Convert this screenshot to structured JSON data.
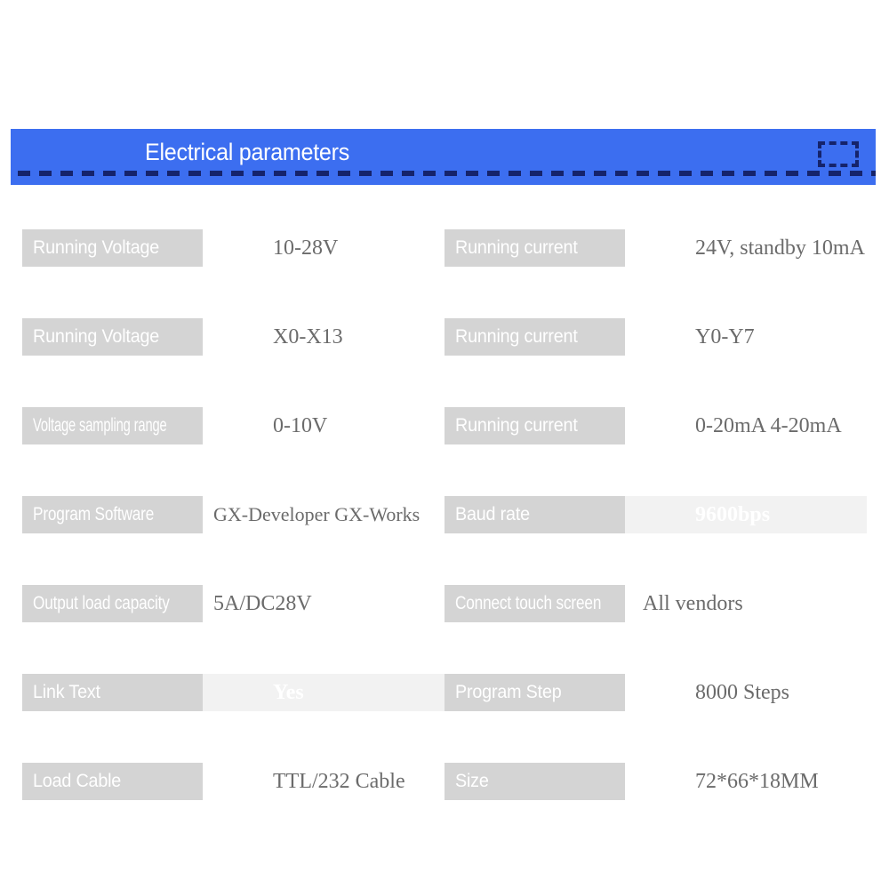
{
  "banner": {
    "title": "Electrical parameters",
    "accent_color": "#3c6ef0",
    "dash_color": "#15236b",
    "marker_icon": "dashed-rectangle-icon"
  },
  "theme": {
    "label_bg": "#d4d4d4",
    "label_text": "#ffffff",
    "value_text": "#6b6b6b",
    "ghost_strip_bg": "#f2f2f2",
    "page_bg": "#ffffff"
  },
  "parameters": {
    "rows": [
      {
        "left": {
          "label": "Running Voltage",
          "value": "10-28V",
          "ghost": false
        },
        "right": {
          "label": "Running current",
          "value": "24V, standby 10mA",
          "ghost": false
        }
      },
      {
        "left": {
          "label": "Running Voltage",
          "value": "X0-X13",
          "ghost": false
        },
        "right": {
          "label": "Running current",
          "value": "Y0-Y7",
          "ghost": false
        }
      },
      {
        "left": {
          "label": "Voltage sampling range",
          "value": "0-10V",
          "ghost": false
        },
        "right": {
          "label": "Running current",
          "value": "0-20mA  4-20mA",
          "ghost": false
        }
      },
      {
        "left": {
          "label": "Program Software",
          "value": "GX-Developer GX-Works",
          "ghost": false
        },
        "right": {
          "label": "Baud rate",
          "value": "9600bps",
          "ghost": true
        }
      },
      {
        "left": {
          "label": "Output load capacity",
          "value": "5A/DC28V",
          "ghost": false
        },
        "right": {
          "label": "Connect touch screen",
          "value": "All vendors",
          "ghost": false
        }
      },
      {
        "left": {
          "label": "Link Text",
          "value": "Yes",
          "ghost": true
        },
        "right": {
          "label": "Program Step",
          "value": "8000 Steps",
          "ghost": false
        }
      },
      {
        "left": {
          "label": "Load Cable",
          "value": "TTL/232 Cable",
          "ghost": false
        },
        "right": {
          "label": "Size",
          "value": "72*66*18MM",
          "ghost": false
        }
      }
    ]
  }
}
